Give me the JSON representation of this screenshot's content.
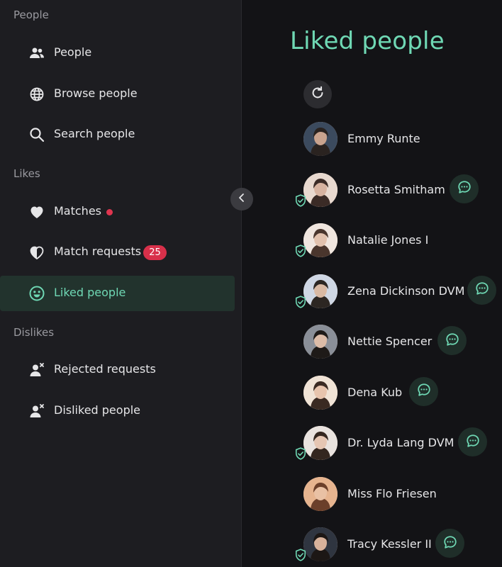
{
  "sidebar": {
    "sections": [
      "People",
      "Likes",
      "Dislikes"
    ],
    "items": [
      {
        "label": "People",
        "icon": "people-icon"
      },
      {
        "label": "Browse people",
        "icon": "globe-people-icon"
      },
      {
        "label": "Search people",
        "icon": "search-icon"
      },
      {
        "label": "Matches",
        "icon": "heart-icon"
      },
      {
        "label": "Match requests",
        "icon": "half-heart-icon",
        "badge": "25"
      },
      {
        "label": "Liked people",
        "icon": "smile-icon",
        "active": true
      },
      {
        "label": "Rejected requests",
        "icon": "person-x-icon"
      },
      {
        "label": "Disliked people",
        "icon": "person-x-icon"
      }
    ]
  },
  "main": {
    "title": "Liked people",
    "people": [
      {
        "name": "Emmy Runte",
        "verified": false,
        "chat": false
      },
      {
        "name": "Rosetta Smitham",
        "verified": true,
        "chat": true
      },
      {
        "name": "Natalie Jones I",
        "verified": true,
        "chat": false
      },
      {
        "name": "Zena Dickinson DVM",
        "verified": true,
        "chat": true
      },
      {
        "name": "Nettie Spencer",
        "verified": false,
        "chat": true
      },
      {
        "name": "Dena Kub",
        "verified": false,
        "chat": true
      },
      {
        "name": "Dr. Lyda Lang DVM",
        "verified": true,
        "chat": true
      },
      {
        "name": "Miss Flo Friesen",
        "verified": false,
        "chat": false
      },
      {
        "name": "Tracy Kessler II",
        "verified": true,
        "chat": true
      }
    ]
  },
  "colors": {
    "accent": "#6fd8b4",
    "badge": "#d8304a",
    "dot": "#e0354f",
    "active_bg": "#22332d"
  }
}
